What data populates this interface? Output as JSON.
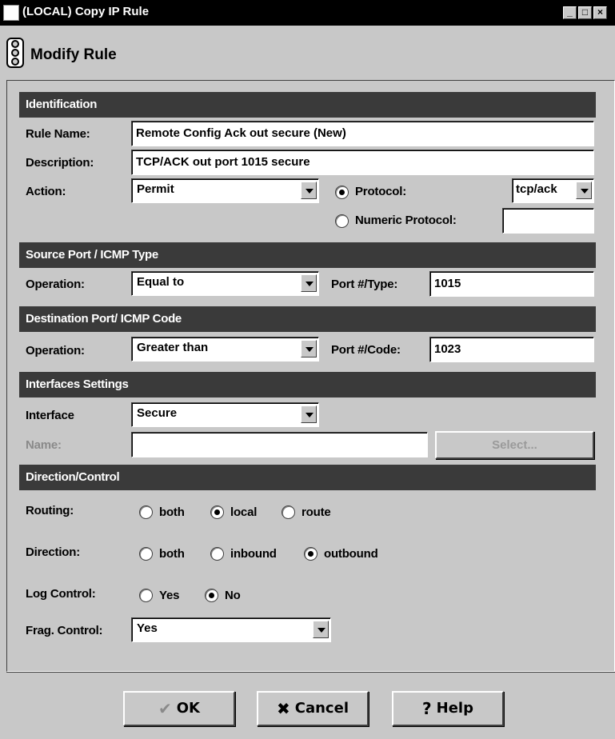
{
  "window": {
    "title": "(LOCAL) Copy IP Rule",
    "min_glyph": "_",
    "max_glyph": "□",
    "close_glyph": "×"
  },
  "header": {
    "title": "Modify Rule"
  },
  "identification": {
    "section_title": "Identification",
    "rule_name_label": "Rule Name:",
    "rule_name_value": "Remote Config Ack out secure (New)",
    "description_label": "Description:",
    "description_value": "TCP/ACK out port 1015 secure",
    "action_label": "Action:",
    "action_value": "Permit",
    "protocol_label": "Protocol:",
    "protocol_value": "tcp/ack",
    "protocol_selected": true,
    "numeric_protocol_label": "Numeric Protocol:",
    "numeric_protocol_value": ""
  },
  "source_port": {
    "section_title": "Source Port / ICMP Type",
    "operation_label": "Operation:",
    "operation_value": "Equal to",
    "port_label": "Port #/Type:",
    "port_value": "1015"
  },
  "destination_port": {
    "section_title": "Destination Port/ ICMP Code",
    "operation_label": "Operation:",
    "operation_value": "Greater than",
    "port_label": "Port #/Code:",
    "port_value": "1023"
  },
  "interfaces": {
    "section_title": "Interfaces Settings",
    "interface_label": "Interface",
    "interface_value": "Secure",
    "name_label": "Name:",
    "name_value": "",
    "select_button": "Select..."
  },
  "direction_control": {
    "section_title": "Direction/Control",
    "routing_label": "Routing:",
    "routing_options": [
      "both",
      "local",
      "route"
    ],
    "routing_selected": "local",
    "direction_label": "Direction:",
    "direction_options": [
      "both",
      "inbound",
      "outbound"
    ],
    "direction_selected": "outbound",
    "log_label": "Log Control:",
    "log_options": [
      "Yes",
      "No"
    ],
    "log_selected": "No",
    "frag_label": "Frag. Control:",
    "frag_value": "Yes"
  },
  "buttons": {
    "ok": "OK",
    "cancel": "Cancel",
    "help": "Help"
  },
  "icons": {
    "app": "tool-icon",
    "header": "traffic-light-icon",
    "ok": "checkmark-icon",
    "cancel": "x-icon",
    "help": "question-mark-icon"
  }
}
